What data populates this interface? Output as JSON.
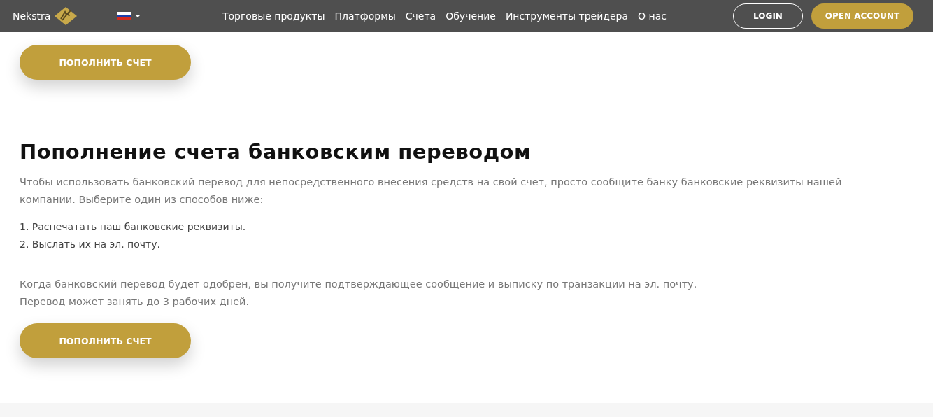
{
  "header": {
    "brand": "Nekstra",
    "nav": [
      "Торговые продукты",
      "Платформы",
      "Счета",
      "Обучение",
      "Инструменты трейдера",
      "О нас"
    ],
    "login": "LOGIN",
    "open_account": "OPEN ACCOUNT"
  },
  "card_button": "ПОПОЛНИТЬ СЧЕТ",
  "bank": {
    "title": "Пополнение счета банковским переводом",
    "intro": "Чтобы использовать банковский перевод для непосредственного внесения средств на свой счет, просто сообщите банку банковские реквизиты нашей компании. Выберите один из способов ниже:",
    "steps": [
      "1. Распечатать наш банковские реквизиты.",
      "2. Выслать их на эл. почту."
    ],
    "note_lines": [
      "Когда банковский перевод будет одобрен, вы получите подтверждающее сообщение и выписку по транзакции на эл. почту.",
      "Перевод может занять до 3 рабочих дней."
    ],
    "button": "ПОПОЛНИТЬ СЧЕТ"
  }
}
